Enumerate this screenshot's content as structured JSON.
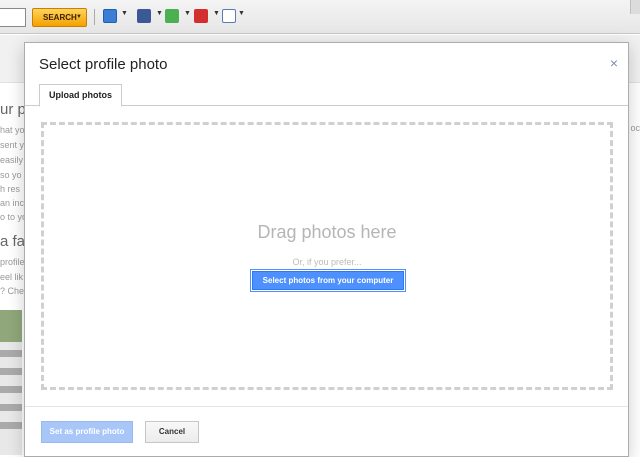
{
  "toolbar": {
    "search_label": "SEARCH",
    "icons": [
      "mail-icon",
      "facebook-icon",
      "puzzle-icon",
      "dice-icon",
      "clipboard-icon"
    ]
  },
  "background_page": {
    "heading_1": "ur pr",
    "lines_1": [
      "hat yo",
      "sent y",
      "easily",
      "so yo",
      "h res",
      "an inc",
      "o to yo"
    ],
    "heading_2": "a fa",
    "lines_2": [
      "profile",
      "eel lik",
      "? Che"
    ],
    "right_text": "oc"
  },
  "dialog": {
    "title": "Select profile photo",
    "close_symbol": "×",
    "tab_label": "Upload photos",
    "drop_title": "Drag photos here",
    "drop_or": "Or, if you prefer...",
    "select_button": "Select photos from your computer",
    "set_button": "Set as profile photo",
    "cancel_button": "Cancel"
  },
  "colors": {
    "primary_button": "#4d90fe",
    "disabled_button": "#a9c6f8",
    "search_button": "#f5a000"
  }
}
